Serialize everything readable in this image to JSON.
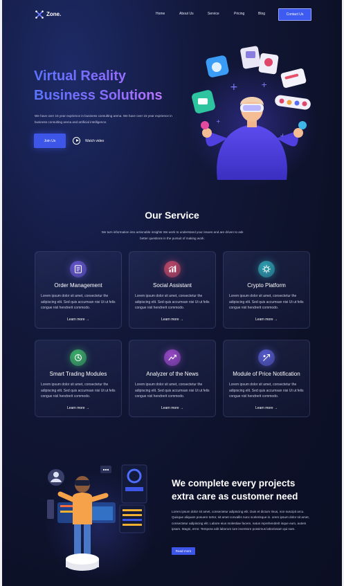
{
  "brand": {
    "name": "Zone."
  },
  "nav": {
    "links": [
      "Home",
      "About Us",
      "Service",
      "Pricing",
      "Blog"
    ],
    "contact_label": "Contact Us"
  },
  "hero": {
    "title_line1": "Virtual Reality",
    "title_line2": "Business Solutions",
    "description": "We have over 15 year exprience in business consulting arena. We have over 15 year exprience in business consulting arena and artificial intelligence.",
    "join_label": "Join Us",
    "watch_label": "Watch video"
  },
  "service": {
    "title": "Our Service",
    "description": "We turn information into actionable insights We work to understand your issues and are driven to ask better questions in the pursuit of making work.",
    "cards": [
      {
        "title": "Order Management",
        "text": "Lorem ipsum dolor sit amet, consectetur the adipiscing elit. Sed quis accumsan nisi Ut ut felis congue nisl hendrerit commodo.",
        "link": "Learn more",
        "icon": "order-icon",
        "color": "#6b5ad6"
      },
      {
        "title": "Social Assistant",
        "text": "Lorem ipsum dolor sit amet, consectetur the adipiscing elit. Sed quis accumsan nisi Ut ut felis congue nisl hendrerit commodo.",
        "link": "Learn more",
        "icon": "chart-icon",
        "color": "#c94a6a"
      },
      {
        "title": "Crypto Platform",
        "text": "Lorem ipsum dolor sit amet, consectetur the adipiscing elit. Sed quis accumsan nisi Ut ut felis congue nisl hendrerit commodo.",
        "link": "Learn more",
        "icon": "crypto-icon",
        "color": "#2fa9b8"
      },
      {
        "title": "Smart Trading Modules",
        "text": "Lorem ipsum dolor sit amet, consectetur the adipiscing elit. Sed quis accumsan nisi Ut ut felis congue nisl hendrerit commodo.",
        "link": "Learn more",
        "icon": "trading-icon",
        "color": "#3fb86a"
      },
      {
        "title": "Analyzer of the News",
        "text": "Lorem ipsum dolor sit amet, consectetur the adipiscing elit. Sed quis accumsan nisi Ut ut felis congue nisl hendrerit commodo.",
        "link": "Learn more",
        "icon": "analyzer-icon",
        "color": "#a04bd0"
      },
      {
        "title": "Module of Price Notification",
        "text": "Lorem ipsum dolor sit amet, consectetur the adipiscing elit. Sed quis accumsan nisi Ut ut felis congue nisl hendrerit commodo.",
        "link": "Learn more",
        "icon": "notification-icon",
        "color": "#5a5fd6"
      }
    ]
  },
  "cta": {
    "title_line1": "We complete every projects",
    "title_line2": "extra care as customer need",
    "text": "Lorem ipsum dolor sit amet, consectetur adipiscing elit. Duis et dictum risus, non suscipit arcu. Quisque aliquam posuere tortor, sit amet convallis nunc scelerisque in. orem ipsum  dolor sit amet, consectetur adipiscing elit. Labore eius molestiae facere, natus reprehenderit isque eum, autem ipsam. Magni, error. Tempora odit laborum iure inventore possimus laboriosam qui nam.",
    "button_label": "Read more"
  },
  "colors": {
    "accent": "#3d56e8",
    "background": "#0d1128"
  }
}
